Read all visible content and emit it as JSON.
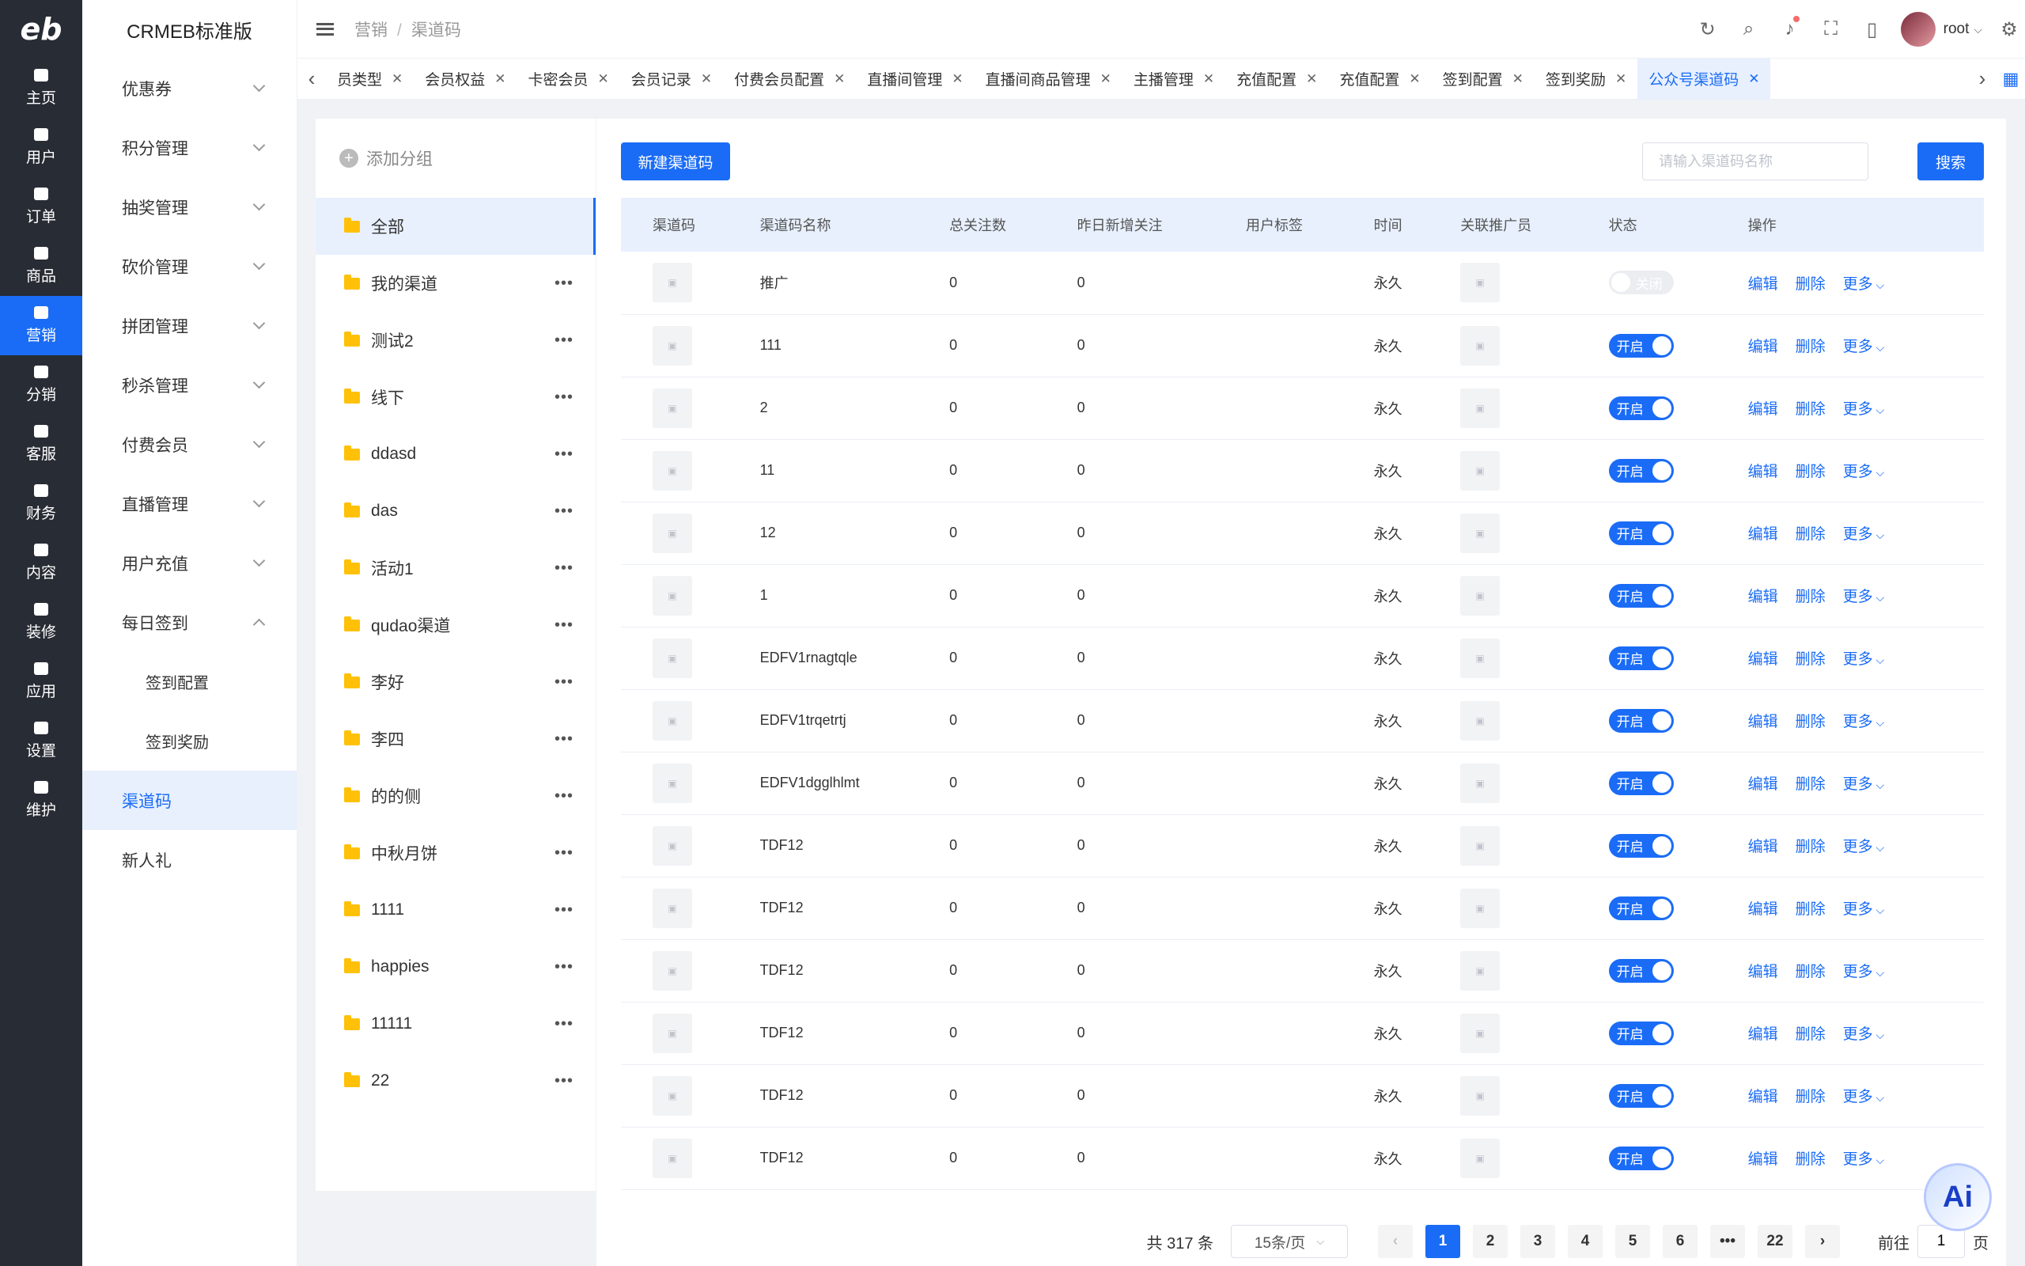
{
  "rail": {
    "logo": "eb",
    "items": [
      {
        "label": "主页",
        "icon": "home-icon"
      },
      {
        "label": "用户",
        "icon": "user-icon"
      },
      {
        "label": "订单",
        "icon": "order-icon"
      },
      {
        "label": "商品",
        "icon": "goods-icon"
      },
      {
        "label": "营销",
        "icon": "marketing-icon",
        "active": true
      },
      {
        "label": "分销",
        "icon": "distribution-icon"
      },
      {
        "label": "客服",
        "icon": "service-icon"
      },
      {
        "label": "财务",
        "icon": "finance-icon"
      },
      {
        "label": "内容",
        "icon": "content-icon"
      },
      {
        "label": "装修",
        "icon": "decorate-icon"
      },
      {
        "label": "应用",
        "icon": "apps-icon"
      },
      {
        "label": "设置",
        "icon": "settings-icon"
      },
      {
        "label": "维护",
        "icon": "maintain-icon"
      }
    ]
  },
  "sidebar": {
    "brand": "CRMEB标准版",
    "items": [
      {
        "label": "优惠券",
        "chevron": "down"
      },
      {
        "label": "积分管理",
        "chevron": "down"
      },
      {
        "label": "抽奖管理",
        "chevron": "down"
      },
      {
        "label": "砍价管理",
        "chevron": "down"
      },
      {
        "label": "拼团管理",
        "chevron": "down"
      },
      {
        "label": "秒杀管理",
        "chevron": "down"
      },
      {
        "label": "付费会员",
        "chevron": "down"
      },
      {
        "label": "直播管理",
        "chevron": "down"
      },
      {
        "label": "用户充值",
        "chevron": "down"
      },
      {
        "label": "每日签到",
        "chevron": "up"
      },
      {
        "label": "签到配置",
        "sub": true
      },
      {
        "label": "签到奖励",
        "sub": true
      },
      {
        "label": "渠道码",
        "active": true
      },
      {
        "label": "新人礼"
      }
    ]
  },
  "header": {
    "breadcrumb": [
      "营销",
      "渠道码"
    ],
    "username": "root",
    "icons": [
      "refresh-icon",
      "search-icon",
      "bell-icon",
      "fullscreen-icon",
      "mobile-icon"
    ]
  },
  "tabs": [
    {
      "label": "员类型"
    },
    {
      "label": "会员权益"
    },
    {
      "label": "卡密会员"
    },
    {
      "label": "会员记录"
    },
    {
      "label": "付费会员配置"
    },
    {
      "label": "直播间管理"
    },
    {
      "label": "直播间商品管理"
    },
    {
      "label": "主播管理"
    },
    {
      "label": "充值配置"
    },
    {
      "label": "充值配置"
    },
    {
      "label": "签到配置"
    },
    {
      "label": "签到奖励"
    },
    {
      "label": "公众号渠道码",
      "active": true
    }
  ],
  "groups": {
    "add_label": "添加分组",
    "items": [
      {
        "label": "全部",
        "active": true
      },
      {
        "label": "我的渠道"
      },
      {
        "label": "测试2"
      },
      {
        "label": "线下"
      },
      {
        "label": "ddasd"
      },
      {
        "label": "das"
      },
      {
        "label": "活动1"
      },
      {
        "label": "qudao渠道"
      },
      {
        "label": "李好"
      },
      {
        "label": "李四"
      },
      {
        "label": "的的侧"
      },
      {
        "label": "中秋月饼"
      },
      {
        "label": "1111"
      },
      {
        "label": "happies"
      },
      {
        "label": "11111"
      },
      {
        "label": "22"
      }
    ]
  },
  "toolbar": {
    "new_label": "新建渠道码",
    "search_placeholder": "请输入渠道码名称",
    "search_label": "搜索"
  },
  "table": {
    "columns": [
      "渠道码",
      "渠道码名称",
      "总关注数",
      "昨日新增关注",
      "用户标签",
      "时间",
      "关联推广员",
      "状态",
      "操作"
    ],
    "actions": {
      "edit": "编辑",
      "delete": "删除",
      "more": "更多"
    },
    "on_text": "开启",
    "off_text": "关闭",
    "rows": [
      {
        "name": "推广",
        "total": "0",
        "yesterday": "0",
        "tag": "",
        "time": "永久",
        "status": "off"
      },
      {
        "name": "111",
        "total": "0",
        "yesterday": "0",
        "tag": "",
        "time": "永久",
        "status": "on"
      },
      {
        "name": "2",
        "total": "0",
        "yesterday": "0",
        "tag": "",
        "time": "永久",
        "status": "on"
      },
      {
        "name": "11",
        "total": "0",
        "yesterday": "0",
        "tag": "",
        "time": "永久",
        "status": "on"
      },
      {
        "name": "12",
        "total": "0",
        "yesterday": "0",
        "tag": "",
        "time": "永久",
        "status": "on"
      },
      {
        "name": "1",
        "total": "0",
        "yesterday": "0",
        "tag": "",
        "time": "永久",
        "status": "on"
      },
      {
        "name": "EDFV1rnagtqle",
        "total": "0",
        "yesterday": "0",
        "tag": "",
        "time": "永久",
        "status": "on"
      },
      {
        "name": "EDFV1trqetrtj",
        "total": "0",
        "yesterday": "0",
        "tag": "",
        "time": "永久",
        "status": "on"
      },
      {
        "name": "EDFV1dgglhlmt",
        "total": "0",
        "yesterday": "0",
        "tag": "",
        "time": "永久",
        "status": "on"
      },
      {
        "name": "TDF12",
        "total": "0",
        "yesterday": "0",
        "tag": "",
        "time": "永久",
        "status": "on"
      },
      {
        "name": "TDF12",
        "total": "0",
        "yesterday": "0",
        "tag": "",
        "time": "永久",
        "status": "on"
      },
      {
        "name": "TDF12",
        "total": "0",
        "yesterday": "0",
        "tag": "",
        "time": "永久",
        "status": "on"
      },
      {
        "name": "TDF12",
        "total": "0",
        "yesterday": "0",
        "tag": "",
        "time": "永久",
        "status": "on"
      },
      {
        "name": "TDF12",
        "total": "0",
        "yesterday": "0",
        "tag": "",
        "time": "永久",
        "status": "on"
      },
      {
        "name": "TDF12",
        "total": "0",
        "yesterday": "0",
        "tag": "",
        "time": "永久",
        "status": "on"
      }
    ]
  },
  "pager": {
    "total": "共 317 条",
    "page_size": "15条/页",
    "pages": [
      "1",
      "2",
      "3",
      "4",
      "5",
      "6",
      "•••",
      "22"
    ],
    "current": "1",
    "goto_label": "前往",
    "goto_value": "1",
    "page_suffix": "页"
  },
  "ai_badge": "Ai",
  "colors": {
    "primary": "#1a6cf6",
    "rail_bg": "#282c34",
    "active_bg": "#e8f0fe"
  }
}
